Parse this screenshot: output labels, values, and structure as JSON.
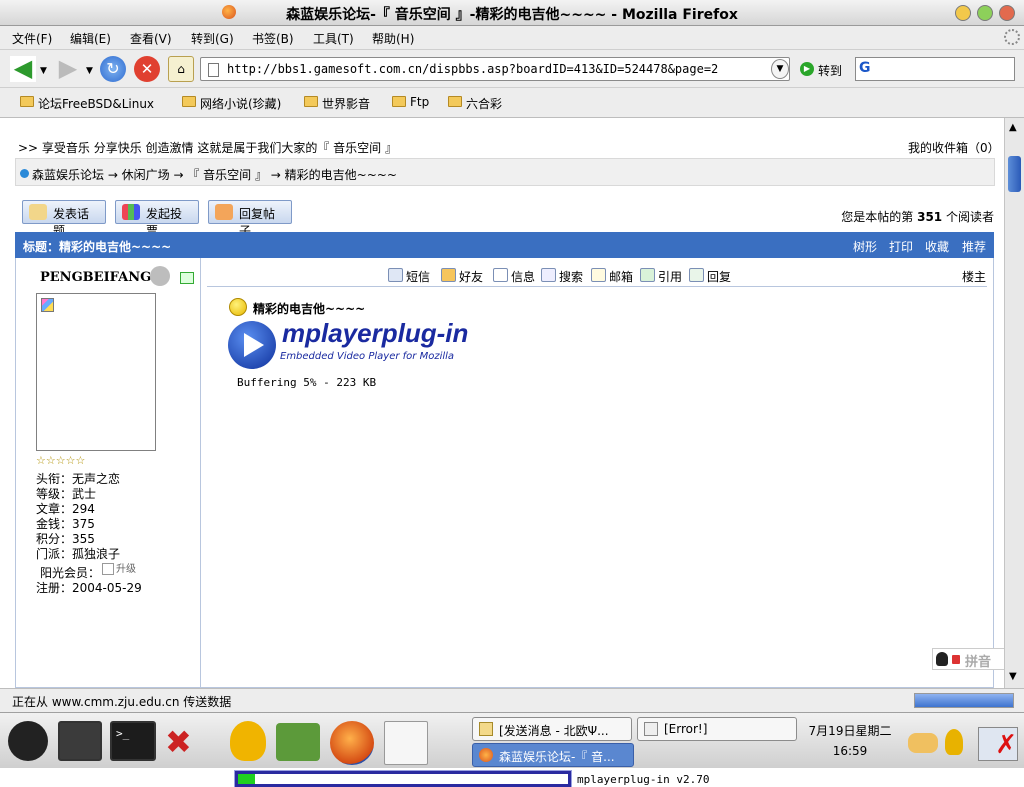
{
  "window": {
    "title": "森蓝娱乐论坛-『 音乐空间 』-精彩的电吉他~~~~ - Mozilla Firefox"
  },
  "menu": {
    "items": [
      "文件(F)",
      "编辑(E)",
      "查看(V)",
      "转到(G)",
      "书签(B)",
      "工具(T)",
      "帮助(H)"
    ]
  },
  "nav": {
    "url": "http://bbs1.gamesoft.com.cn/dispbbs.asp?boardID=413&ID=524478&page=2",
    "go_label": "转到",
    "search_value": "G"
  },
  "bookmarks": [
    "论坛FreeBSD&Linux",
    "网络小说(珍藏)",
    "世界影音",
    "Ftp",
    "六合彩"
  ],
  "page": {
    "slogan": ">>  享受音乐 分享快乐 创造激情 这就是属于我们大家的『 音乐空间 』",
    "inbox": "我的收件箱（0）",
    "breadcrumb": "森蓝娱乐论坛 → 休闲广场 → 『 音乐空间 』 → 精彩的电吉他~~~~",
    "buttons": {
      "new_topic": "发表话题",
      "new_poll": "发起投票",
      "reply": "回复帖子"
    },
    "reader_prefix": "您是本帖的第",
    "reader_count": "351",
    "reader_suffix": "个阅读者",
    "post_title": "标题：精彩的电吉他~~~~",
    "post_actions": [
      "树形",
      "打印",
      "收藏",
      "推荐"
    ],
    "author": {
      "name": "PENGBEIFANG",
      "rating": "☆☆☆☆☆",
      "stats": {
        "title_label": "头衔：无声之恋",
        "level_label": "等级：武士",
        "posts_label": "文章：294",
        "money_label": "金钱：375",
        "points_label": "积分：355",
        "sect_label": "门派：孤独浪子",
        "sun_label": "阳光会员：",
        "upgrade_label": "升级",
        "reg_label": "注册：2004-05-29"
      }
    },
    "tools": [
      "短信",
      "好友",
      "信息",
      "搜索",
      "邮箱",
      "引用",
      "回复"
    ],
    "floor": "楼主",
    "post_subject": "精彩的电吉他~~~~",
    "plugin": {
      "title": "mplayerplug-in",
      "subtitle": "Embedded Video Player for Mozilla",
      "buffering": "Buffering 5% - 223 KB",
      "version": "mplayerplug-in v2.70",
      "progress": 0.05
    }
  },
  "status": {
    "text": "正在从 www.cmm.zju.edu.cn 传送数据"
  },
  "taskbar": {
    "tasks": [
      "[发送消息 - 北欧Ψ...",
      "[Error!]",
      "森蓝娱乐论坛-『 音..."
    ],
    "date": "7月19日星期二",
    "time": "16:59",
    "ime": "拼音"
  },
  "colors": {
    "header_blue": "#3a6fc1",
    "link_blue": "#1f3f8f",
    "progress_green": "#20d020",
    "progress_border": "#2a2aa0"
  }
}
